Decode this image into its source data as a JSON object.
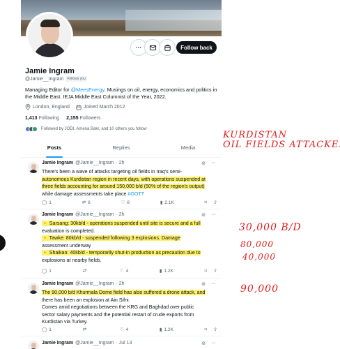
{
  "profile": {
    "name": "Jamie Ingram",
    "handle": "@Jamie__Ingram",
    "follows_you": "Follows you",
    "bio_prefix": "Managing Editor for ",
    "bio_link": "@MeesEnergy",
    "bio_suffix": ".  Musings on oil, energy, economics and politics in the Middle East. IEJA Middle East Columnist of the Year, 2022.",
    "location": "London, England",
    "joined": "Joined March 2012",
    "following_count": "1,413",
    "following_label": "Following",
    "followers_count": "2,155",
    "followers_label": "Followers",
    "followed_by": "Followed by JODI, Amena Bakr, and 10 others you follow"
  },
  "header_actions": {
    "follow_back": "Follow back",
    "more": "···"
  },
  "tabs": [
    {
      "label": "Posts",
      "active": true
    },
    {
      "label": "Replies",
      "active": false
    },
    {
      "label": "Media",
      "active": false
    }
  ],
  "tweets": [
    {
      "name": "Jamie Ingram",
      "handle": "@Jamie__Ingram",
      "time": "· 2h",
      "text_lines": [
        "There's been a wave of attacks targeting oil fields in Iraq's semi-",
        "autonomous Kurdistan region in recent days, with operations suspended at",
        "three fields accounting for around 150,000 b/d (50% of the region's output)",
        "while damage assessments take place "
      ],
      "hashtag": "#OOTT",
      "actions": {
        "reply": "1",
        "retweet": "6",
        "like": "8",
        "views": "2.1K"
      }
    },
    {
      "name": "Jamie Ingram",
      "handle": "@Jamie__Ingram",
      "time": "· 2h",
      "text_lines": [
        "🔸 Sarsang: 30kb/d - operations suspended until site is secure and a full",
        "evaluation is completed.",
        "🔸 Tawke: 80kb/d - suspended following 3 explosions. Damage",
        "assessment underway",
        "🔸 Shaikan: 40kb/d - temporarily shut-in production as precaution due to",
        "explosions at nearby fields."
      ],
      "actions": {
        "reply": "1",
        "retweet": "",
        "like": "4",
        "views": "1.2K"
      }
    },
    {
      "name": "Jamie Ingram",
      "handle": "@Jamie__Ingram",
      "time": "· 2h",
      "text_lines": [
        "The 90,000 b/d Khurmala Dome field has also suffered a drone attack, and",
        "there has been an explosion at Ain Sifni.",
        "Comes amid negotiations between the KRG and Baghdad over public",
        "sector salary payments and the potential restart of crude exports from",
        "Kurdistan via Turkey."
      ],
      "actions": {
        "reply": "1",
        "retweet": "",
        "like": "4",
        "views": "1.2K"
      }
    },
    {
      "name": "Jamie Ingram",
      "handle": "@Jamie__Ingram",
      "time": "· Jul 13",
      "text_lines": [],
      "actions": {}
    }
  ],
  "annotations": {
    "line1": "KURDISTAN",
    "line2": "OIL FIELDS ATTACKED",
    "n1": "30,000 B/D",
    "n2": "80,000",
    "n3": "40,000",
    "n4": "90,000",
    "color": "#e21b1b"
  },
  "icons": [
    "more-icon",
    "message-icon",
    "notification-icon",
    "location-icon",
    "calendar-icon",
    "reply-icon",
    "retweet-icon",
    "like-icon",
    "views-icon",
    "bookmark-icon",
    "share-icon",
    "grok-icon"
  ],
  "colors": {
    "accent": "#1d9bf0",
    "highlight": "#fff16a",
    "text": "#0f1419",
    "muted": "#536471"
  }
}
